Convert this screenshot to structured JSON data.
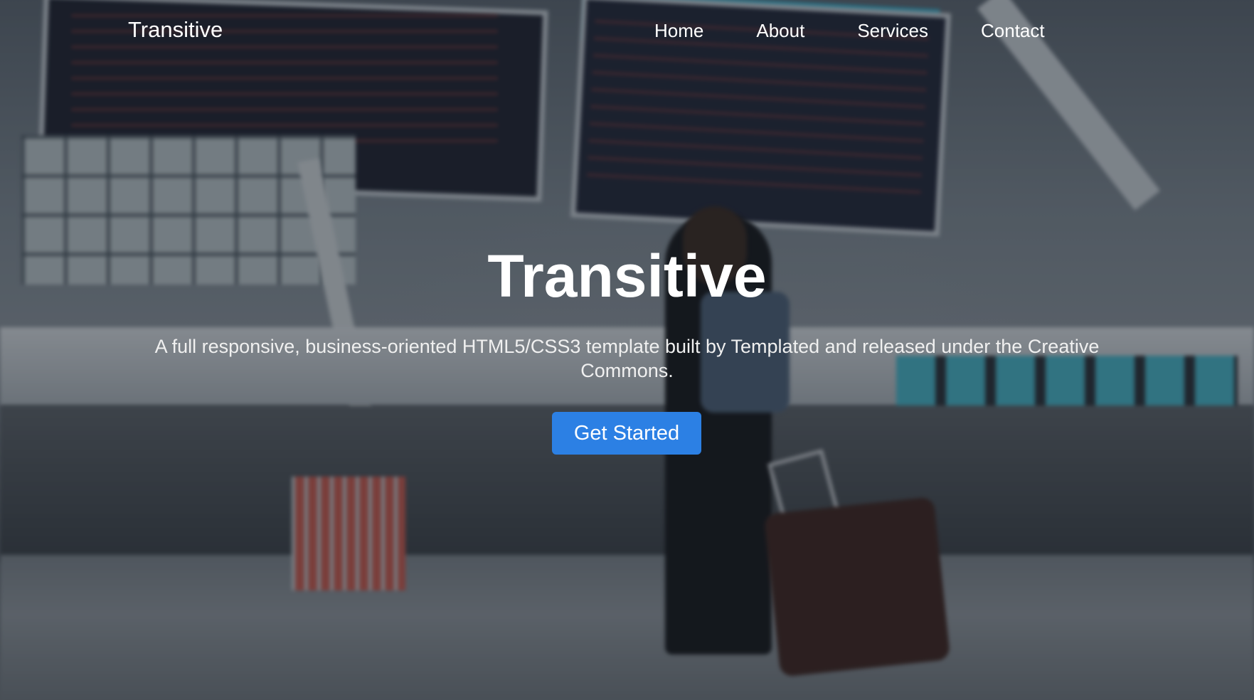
{
  "nav": {
    "brand": "Transitive",
    "links": [
      "Home",
      "About",
      "Services",
      "Contact"
    ]
  },
  "hero": {
    "title": "Transitive",
    "subtitle": "A full responsive, business-oriented HTML5/CSS3 template built by Templated and released under the Creative Commons.",
    "cta_label": "Get Started",
    "background_image": "airport-terminal-traveler-photo"
  },
  "colors": {
    "accent": "#2c80e4",
    "text": "#ffffff"
  }
}
